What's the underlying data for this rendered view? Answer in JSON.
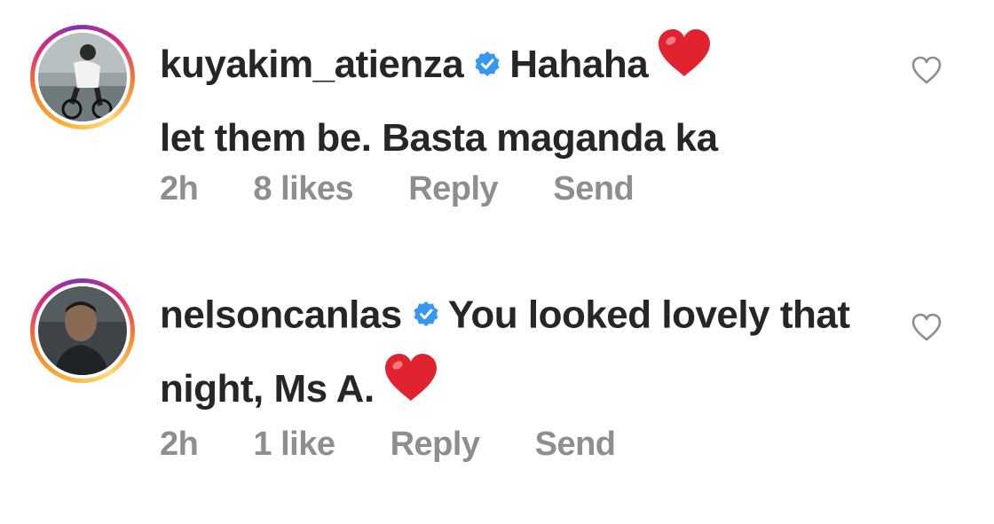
{
  "comments": [
    {
      "username": "kuyakim_atienza",
      "verified": true,
      "text_before_heart": "Hahaha",
      "text_after_heart": "let them be. Basta maganda ka",
      "time": "2h",
      "likes": "8 likes",
      "reply_label": "Reply",
      "send_label": "Send",
      "avatar": "cyclist-photo"
    },
    {
      "username": "nelsoncanlas",
      "verified": true,
      "text_before_heart": "You looked lovely that night, Ms A.",
      "text_after_heart": "",
      "time": "2h",
      "likes": "1 like",
      "reply_label": "Reply",
      "send_label": "Send",
      "avatar": "portrait-photo"
    }
  ],
  "colors": {
    "text": "#262626",
    "meta": "#8e8e8e",
    "verified_blue": "#3897f0",
    "heart_red": "#e0232e"
  },
  "icons": {
    "verified": "verified-badge-icon",
    "inline_heart": "red-heart-emoji-icon",
    "like": "heart-outline-icon"
  }
}
